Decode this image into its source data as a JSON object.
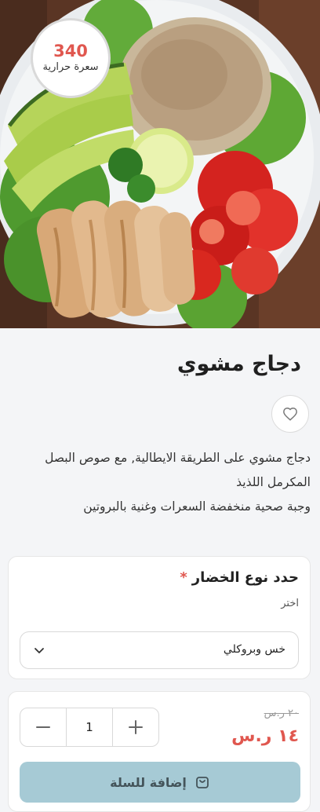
{
  "product": {
    "calories_value": "340",
    "calories_label": "سعرة حرارية",
    "name": "دجاج مشوي",
    "description_line1": "دجاج مشوي على الطريقة الايطالية, مع صوص البصل المكرمل اللذيذ",
    "description_line2": "وجبة صحية منخفضة السعرات وغنية بالبروتين"
  },
  "options": {
    "title": "حدد نوع الخضار",
    "required_mark": "*",
    "subtitle": "اختر",
    "selected_value": "خس وبروكلي"
  },
  "purchase": {
    "old_price": "٢٠ ر.س",
    "new_price": "١٤ ر.س",
    "quantity": "1",
    "add_to_cart_label": "إضافة للسلة"
  },
  "icons": {
    "favorite": "heart-outline-icon",
    "dropdown": "chevron-down-icon",
    "minus": "minus-icon",
    "plus": "plus-icon",
    "cart": "cart-icon"
  },
  "colors": {
    "accent": "#e0574f",
    "button_bg": "#a6cad5",
    "page_bg": "#f4f5f7"
  }
}
